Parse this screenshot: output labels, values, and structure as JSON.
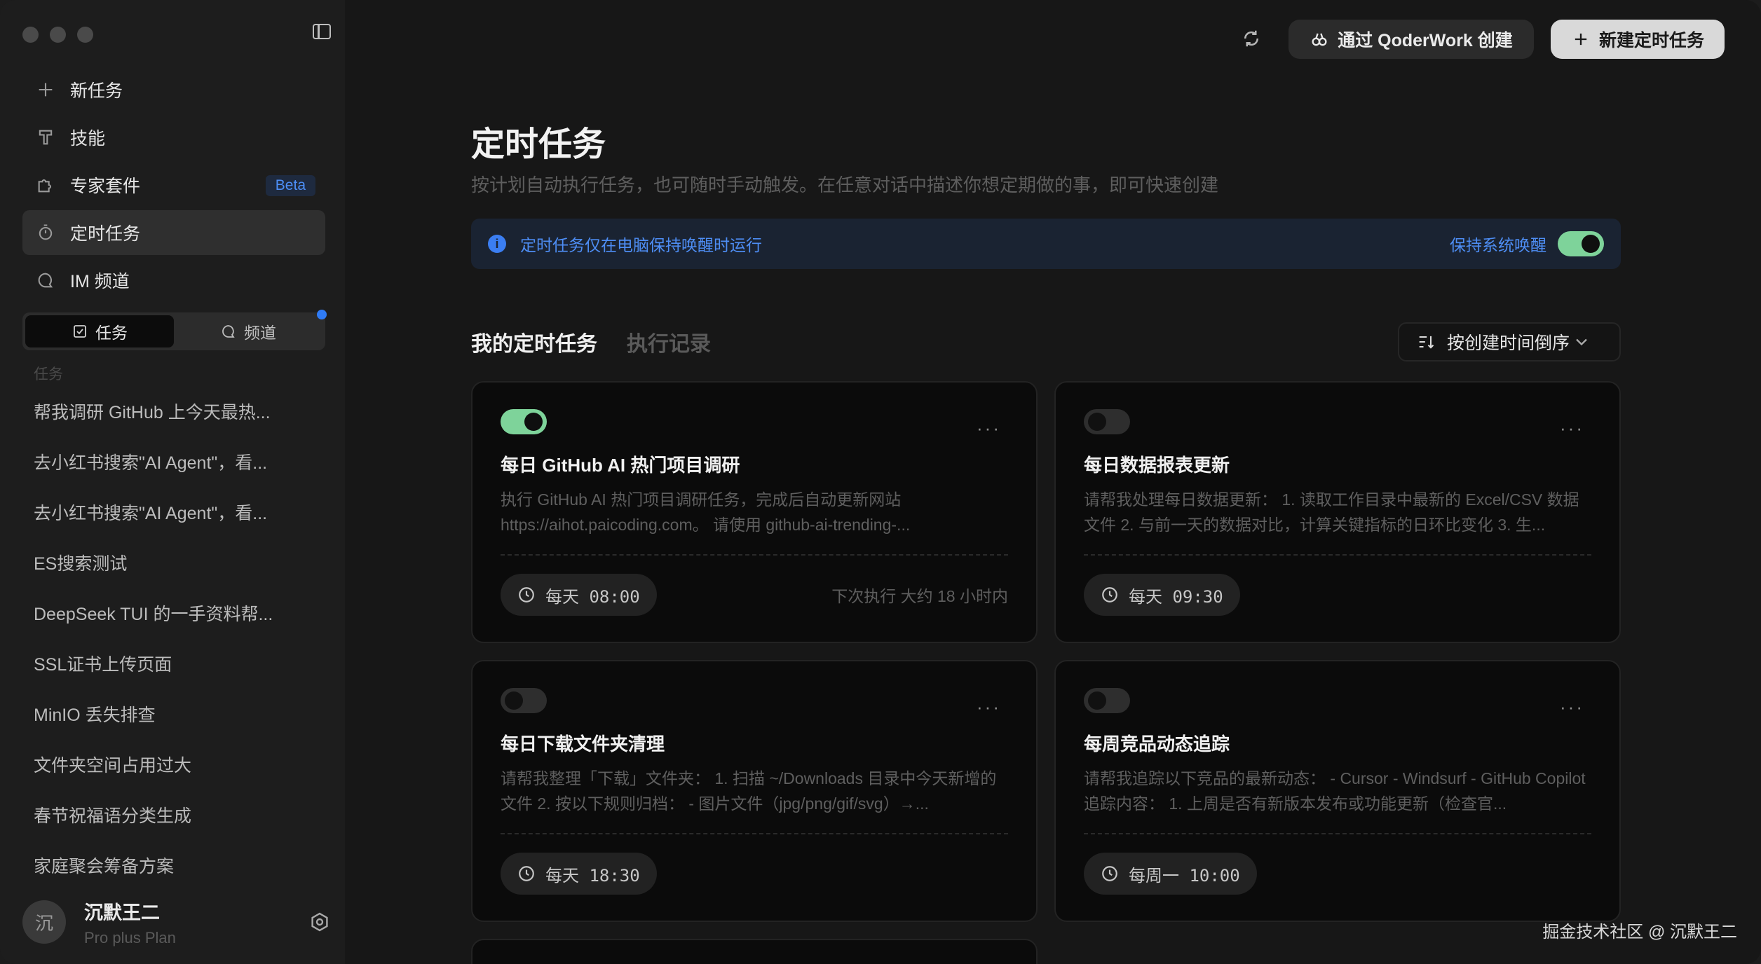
{
  "sidebar": {
    "nav": [
      {
        "label": "新任务",
        "icon": "plus-icon"
      },
      {
        "label": "技能",
        "icon": "skill-icon"
      },
      {
        "label": "专家套件",
        "icon": "puzzle-icon",
        "badge": "Beta"
      },
      {
        "label": "定时任务",
        "icon": "timer-icon",
        "active": true
      },
      {
        "label": "IM 频道",
        "icon": "chat-icon"
      }
    ],
    "segment": {
      "tasks": "任务",
      "channels": "频道"
    },
    "section_label": "任务",
    "history": [
      "帮我调研 GitHub 上今天最热...",
      "去小红书搜索\"AI Agent\"，看...",
      "去小红书搜索\"AI Agent\"，看...",
      "ES搜索测试",
      "DeepSeek TUI 的一手资料帮...",
      "SSL证书上传页面",
      "MinIO 丢失排查",
      "文件夹空间占用过大",
      "春节祝福语分类生成",
      "家庭聚会筹备方案"
    ],
    "user": {
      "avatar": "沉",
      "name": "沉默王二",
      "plan": "Pro plus Plan"
    }
  },
  "topbar": {
    "qoder_btn": "通过 QoderWork 创建",
    "new_btn": "新建定时任务"
  },
  "page": {
    "title": "定时任务",
    "subtitle": "按计划自动执行任务，也可随时手动触发。在任意对话中描述你想定期做的事，即可快速创建",
    "notice": "定时任务仅在电脑保持唤醒时运行",
    "keep_awake": "保持系统唤醒",
    "keep_awake_on": true
  },
  "tabs": {
    "mine": "我的定时任务",
    "history": "执行记录"
  },
  "sort": "按创建时间倒序",
  "cards": [
    {
      "enabled": true,
      "title": "每日 GitHub AI 热门项目调研",
      "desc": "执行 GitHub AI 热门项目调研任务，完成后自动更新网站 https://aihot.paicoding.com。 请使用 github-ai-trending-...",
      "schedule": "每天 08:00",
      "next": "下次执行 大约 18 小时内"
    },
    {
      "enabled": false,
      "title": "每日数据报表更新",
      "desc": "请帮我处理每日数据更新： 1. 读取工作目录中最新的 Excel/CSV 数据文件 2. 与前一天的数据对比，计算关键指标的日环比变化 3. 生...",
      "schedule": "每天 09:30",
      "next": ""
    },
    {
      "enabled": false,
      "title": "每日下载文件夹清理",
      "desc": "请帮我整理「下载」文件夹： 1. 扫描 ~/Downloads 目录中今天新增的文件 2. 按以下规则归档： - 图片文件（jpg/png/gif/svg）→...",
      "schedule": "每天 18:30",
      "next": ""
    },
    {
      "enabled": false,
      "title": "每周竞品动态追踪",
      "desc": "请帮我追踪以下竞品的最新动态： - Cursor - Windsurf - GitHub Copilot 追踪内容： 1. 上周是否有新版本发布或功能更新（检查官...",
      "schedule": "每周一 10:00",
      "next": ""
    }
  ],
  "watermark": "掘金技术社区 @ 沉默王二"
}
